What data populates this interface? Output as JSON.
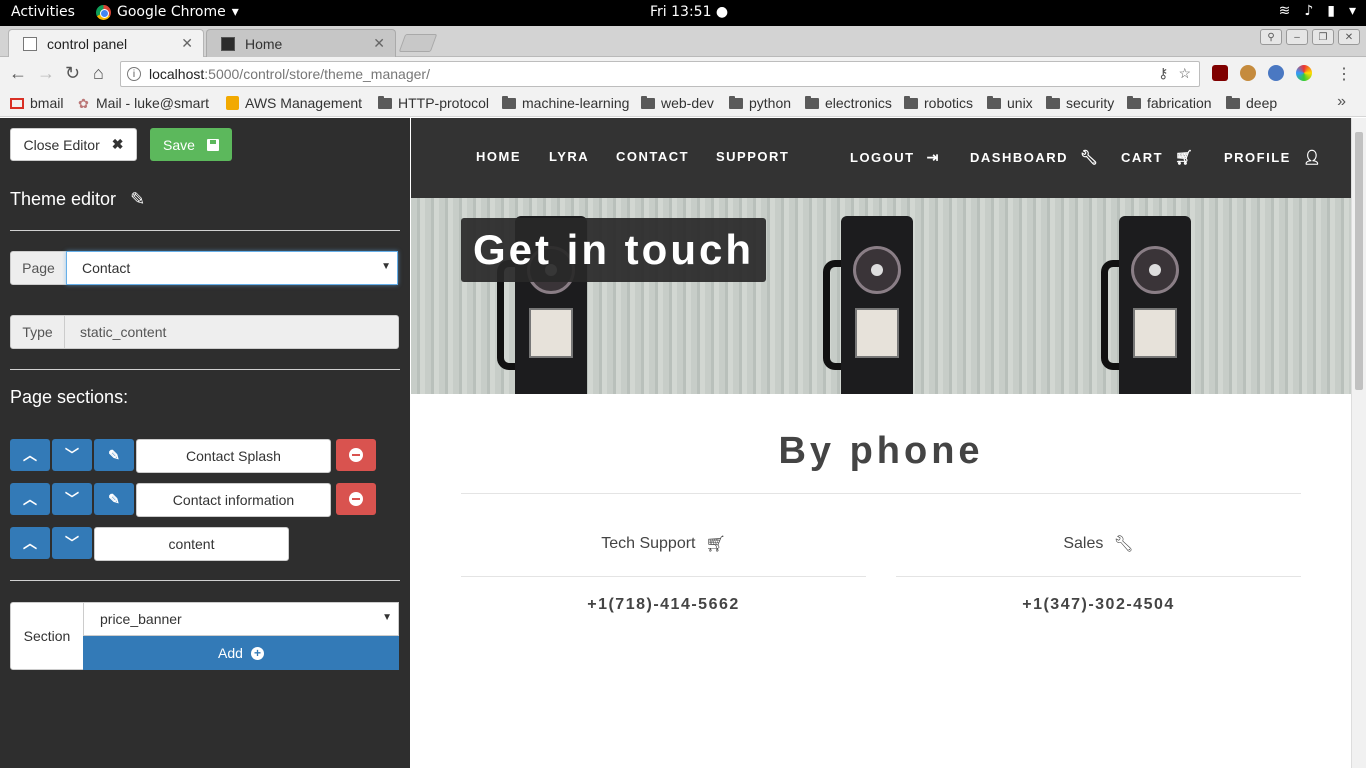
{
  "system": {
    "activities": "Activities",
    "app_name": "Google Chrome",
    "clock": "Fri 13:51"
  },
  "browser": {
    "tabs": [
      {
        "label": "control panel"
      },
      {
        "label": "Home"
      }
    ],
    "url_host": "localhost",
    "url_path": ":5000/control/store/theme_manager/",
    "bookmarks": [
      "bmail",
      "Mail - luke@smart",
      "AWS Management",
      "HTTP-protocol",
      "machine-learning",
      "web-dev",
      "python",
      "electronics",
      "robotics",
      "unix",
      "security",
      "fabrication",
      "deep"
    ]
  },
  "editor": {
    "close_label": "Close Editor",
    "save_label": "Save",
    "title": "Theme editor",
    "page_label": "Page",
    "page_value": "Contact",
    "type_label": "Type",
    "type_value": "static_content",
    "sections_title": "Page sections:",
    "sections": [
      {
        "name": "Contact Splash"
      },
      {
        "name": "Contact information"
      },
      {
        "name": "content"
      }
    ],
    "section_label": "Section",
    "section_value": "price_banner",
    "add_label": "Add"
  },
  "site": {
    "nav": [
      "HOME",
      "LYRA",
      "CONTACT",
      "SUPPORT",
      "LOGOUT",
      "DASHBOARD",
      "CART",
      "PROFILE"
    ],
    "hero_title": "Get in touch",
    "heading": "By phone",
    "contacts": [
      {
        "name": "Tech Support",
        "number": "+1(718)-414-5662"
      },
      {
        "name": "Sales",
        "number": "+1(347)-302-4504"
      }
    ]
  },
  "colors": {
    "save_green": "#5cb85c",
    "primary_blue": "#337ab7",
    "danger_red": "#d9534f",
    "editor_bg": "#2e2e2e",
    "nav_bg": "#333333"
  }
}
